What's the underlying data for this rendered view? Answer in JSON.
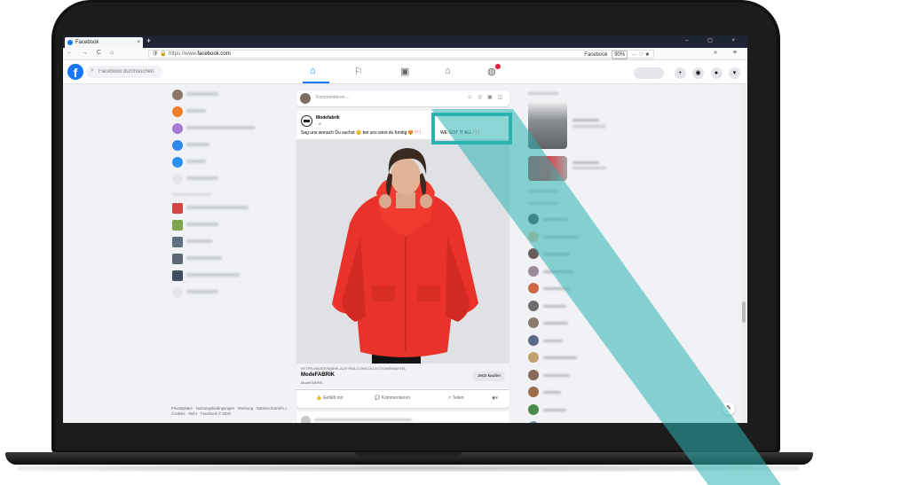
{
  "browser": {
    "tab_title": "Facebook",
    "tab_close": "×",
    "new_tab": "+",
    "window_controls": "– ▢ ×",
    "nav_buttons": "← → C ⌂",
    "url_prefix": "https://www.",
    "url_domain": "facebook.com",
    "url_icons": "🛡 🔒",
    "bookmark_label": "Facebook",
    "zoom": "90%",
    "url_actions": "··· ♡ ★",
    "menu": "» ≡"
  },
  "facebook": {
    "logo": "f",
    "search_placeholder": "Facebook durchsuchen",
    "nav_icons": [
      "home-icon",
      "pages-icon",
      "watch-icon",
      "marketplace-icon",
      "groups-icon"
    ],
    "header_buttons": [
      "+",
      "◉",
      "●",
      "▾"
    ]
  },
  "left_sidebar": {
    "rows": [
      {
        "icon": "avatar-icon",
        "color": "#8c7768"
      },
      {
        "icon": "flag-icon",
        "color": "#f07b29"
      },
      {
        "icon": "covid-icon",
        "color": "#a87ad4"
      },
      {
        "icon": "friends-icon",
        "color": "#2f88e9"
      },
      {
        "icon": "groups-icon",
        "color": "#2b8ff0"
      },
      {
        "icon": "more-icon",
        "color": "#e4e6eb"
      }
    ],
    "shortcut_rows": [
      {
        "icon": "shortcut-1-icon",
        "color": "#d64646"
      },
      {
        "icon": "shortcut-2-icon",
        "color": "#7ba24c"
      },
      {
        "icon": "shortcut-3-icon",
        "color": "#5d6f80"
      },
      {
        "icon": "shortcut-4-icon",
        "color": "#5b6876"
      },
      {
        "icon": "shortcut-5-icon",
        "color": "#3f5064"
      },
      {
        "icon": "more-icon",
        "color": "#e4e6eb"
      }
    ],
    "footer": "Privatsphäre · Nutzungsbedingungen · Werbung · Datenschutzinfo ▷ · Cookies · Mehr · Facebook © 2020"
  },
  "composer": {
    "placeholder": "Kommentieren ...",
    "icons": "☺ ◎ ▣ ◫"
  },
  "post": {
    "author": "Modefabrik",
    "meta": "· ⊘",
    "more": "···",
    "text": "Sag uns wonach Du suchst 😊 bei uns wirst du fündig 😍",
    "bangs": "! ! !",
    "text_highlight": "WE GOT IT ALL",
    "text_highlight_bangs": "! ! !",
    "link_url": "HTTPS://MODEFABRIK-AUSTRIA.COM/COLLECTIONS/MANTEL",
    "link_title": "ModeFABRIK",
    "link_desc": "ModeFABRIK",
    "cta": "Jetzt kaufen",
    "actions": {
      "like": "👍 Gefällt mir",
      "comment": "💬 Kommentieren",
      "share": "↗ Teilen",
      "reaction": "◉▾"
    },
    "colors": {
      "jacket": "#e8322a",
      "background": "#e3e5e8"
    }
  },
  "right_sidebar": {
    "sponsored": [
      {
        "image": "coat-product-image",
        "color": "#8a8d92"
      },
      {
        "image": "red-jacket-product-image",
        "color": "#d7414a"
      }
    ],
    "contacts": [
      {
        "color": "#555"
      },
      {
        "color": "#e7c597"
      },
      {
        "color": "#6a5a5a"
      },
      {
        "color": "#9a8a9a"
      },
      {
        "color": "#cc6644"
      },
      {
        "color": "#6d6d6d"
      },
      {
        "color": "#8a7a6a"
      },
      {
        "color": "#5a6a8a"
      },
      {
        "color": "#c0a070"
      },
      {
        "color": "#8a6a5a"
      },
      {
        "color": "#9b6b4b"
      },
      {
        "color": "#4a8a4a"
      },
      {
        "color": "#7a9aaa"
      },
      {
        "color": "#4a6a9a"
      }
    ]
  },
  "highlight_color": "#2bb3b1",
  "edit_button": "✎"
}
